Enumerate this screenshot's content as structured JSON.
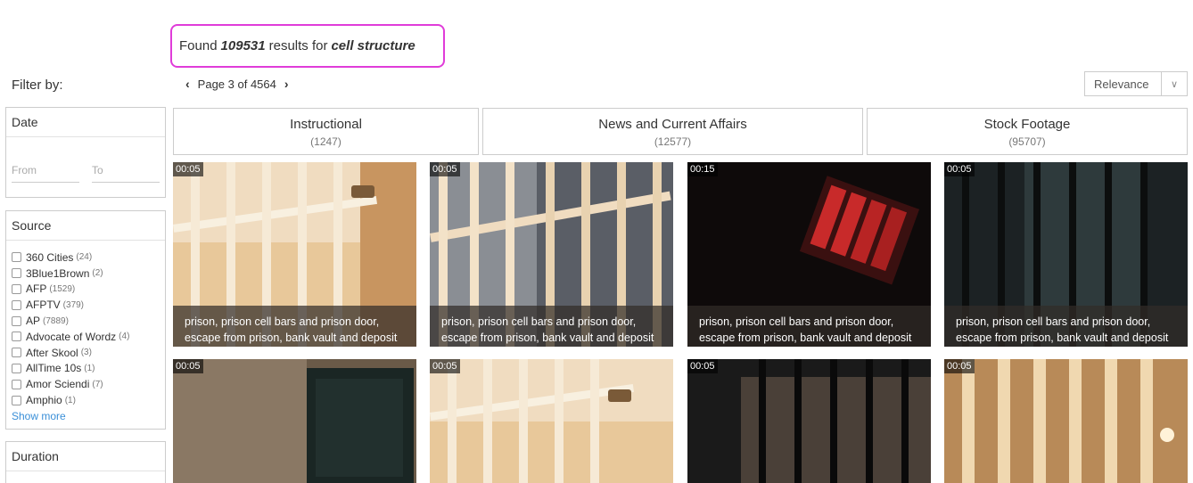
{
  "header": {
    "found_prefix": "Found",
    "result_count": "109531",
    "results_for": "results for",
    "query": "cell structure"
  },
  "filter_by": "Filter by:",
  "pager": {
    "label": "Page 3 of 4564"
  },
  "sort": {
    "selected": "Relevance"
  },
  "sidebar": {
    "date": {
      "title": "Date",
      "from_placeholder": "From",
      "to_placeholder": "To"
    },
    "source": {
      "title": "Source",
      "items": [
        {
          "label": "360 Cities",
          "count": "(24)"
        },
        {
          "label": "3Blue1Brown",
          "count": "(2)"
        },
        {
          "label": "AFP",
          "count": "(1529)"
        },
        {
          "label": "AFPTV",
          "count": "(379)"
        },
        {
          "label": "AP",
          "count": "(7889)"
        },
        {
          "label": "Advocate of Wordz",
          "count": "(4)"
        },
        {
          "label": "After Skool",
          "count": "(3)"
        },
        {
          "label": "AllTime 10s",
          "count": "(1)"
        },
        {
          "label": "Amor Sciendi",
          "count": "(7)"
        },
        {
          "label": "Amphio",
          "count": "(1)"
        }
      ],
      "show_more": "Show more"
    },
    "duration": {
      "title": "Duration"
    }
  },
  "categories": [
    {
      "name": "Instructional",
      "count": "(1247)"
    },
    {
      "name": "News and Current Affairs",
      "count": "(12577)"
    },
    {
      "name": "Stock Footage",
      "count": "(95707)"
    }
  ],
  "videos": [
    {
      "duration": "00:05",
      "caption_line1": "prison, prison cell bars and prison door,",
      "caption_line2": "escape from prison, bank vault and deposit"
    },
    {
      "duration": "00:05",
      "caption_line1": "prison, prison cell bars and prison door,",
      "caption_line2": "escape from prison, bank vault and deposit"
    },
    {
      "duration": "00:15",
      "caption_line1": "prison, prison cell bars and prison door,",
      "caption_line2": "escape from prison, bank vault and deposit"
    },
    {
      "duration": "00:05",
      "caption_line1": "prison, prison cell bars and prison door,",
      "caption_line2": "escape from prison, bank vault and deposit"
    },
    {
      "duration": "00:05"
    },
    {
      "duration": "00:05"
    },
    {
      "duration": "00:05"
    },
    {
      "duration": "00:05"
    }
  ],
  "colors": {
    "highlight_border": "#e03cd9",
    "link": "#3a8fd8"
  }
}
